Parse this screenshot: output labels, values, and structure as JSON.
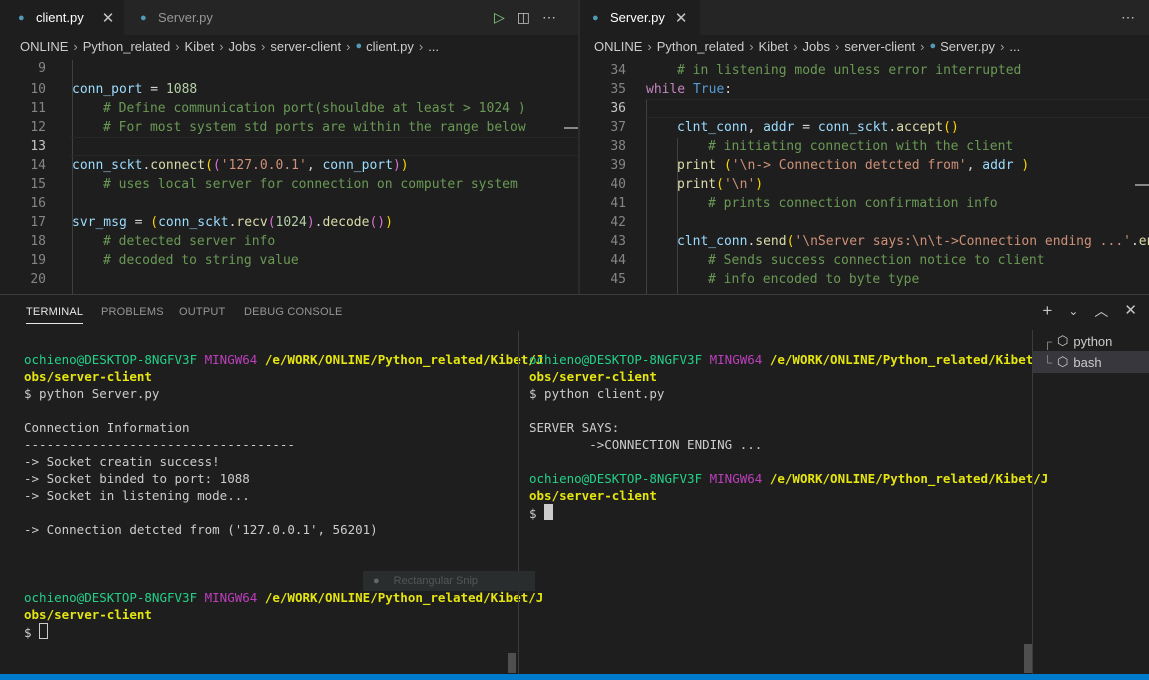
{
  "editor_left": {
    "tabs": [
      {
        "label": "client.py",
        "active": true
      },
      {
        "label": "Server.py",
        "active": false
      }
    ],
    "breadcrumb": [
      "ONLINE",
      "Python_related",
      "Kibet",
      "Jobs",
      "server-client",
      "client.py",
      "..."
    ],
    "line_numbers": [
      "9",
      "10",
      "11",
      "12",
      "13",
      "14",
      "15",
      "16",
      "17",
      "18",
      "19",
      "20"
    ]
  },
  "editor_right": {
    "tabs": [
      {
        "label": "Server.py",
        "active": true
      }
    ],
    "breadcrumb": [
      "ONLINE",
      "Python_related",
      "Kibet",
      "Jobs",
      "server-client",
      "Server.py",
      "..."
    ],
    "line_numbers": [
      "34",
      "35",
      "36",
      "37",
      "38",
      "39",
      "40",
      "41",
      "42",
      "43",
      "44",
      "45"
    ]
  },
  "panel": {
    "tabs": [
      "TERMINAL",
      "PROBLEMS",
      "OUTPUT",
      "DEBUG CONSOLE"
    ],
    "terminals": [
      {
        "name": "python"
      },
      {
        "name": "bash",
        "selected": true
      }
    ],
    "left": {
      "prompt_user": "ochieno@DESKTOP-8NGFV3F",
      "prompt_env": "MINGW64",
      "prompt_path_1": "/e/WORK/ONLINE/Python_related/Kibet/J",
      "prompt_path_2": "obs/server-client",
      "cmd": "$ python Server.py",
      "out": [
        "Connection Information",
        "------------------------------------",
        "-> Socket creatin success!",
        "-> Socket binded to port: 1088",
        "-> Socket in listening mode...",
        "",
        "-> Connection detcted from ('127.0.0.1', 56201)"
      ],
      "dollar": "$"
    },
    "right": {
      "prompt_user": "ochieno@DESKTOP-8NGFV3F",
      "prompt_env": "MINGW64",
      "prompt_path_1": "/e/WORK/ONLINE/Python_related/Kibet/J",
      "prompt_path_2": "obs/server-client",
      "cmd": "$ python client.py",
      "out": [
        "SERVER SAYS:",
        "        ->CONNECTION ENDING ..."
      ],
      "dollar": "$"
    }
  },
  "overlay": {
    "snip_label": "Rectangular Snip"
  },
  "colors": {
    "accent": "#007acc",
    "prompt_user": "#23d18b",
    "prompt_env": "#bc3fbc",
    "prompt_path": "#e5e510"
  }
}
